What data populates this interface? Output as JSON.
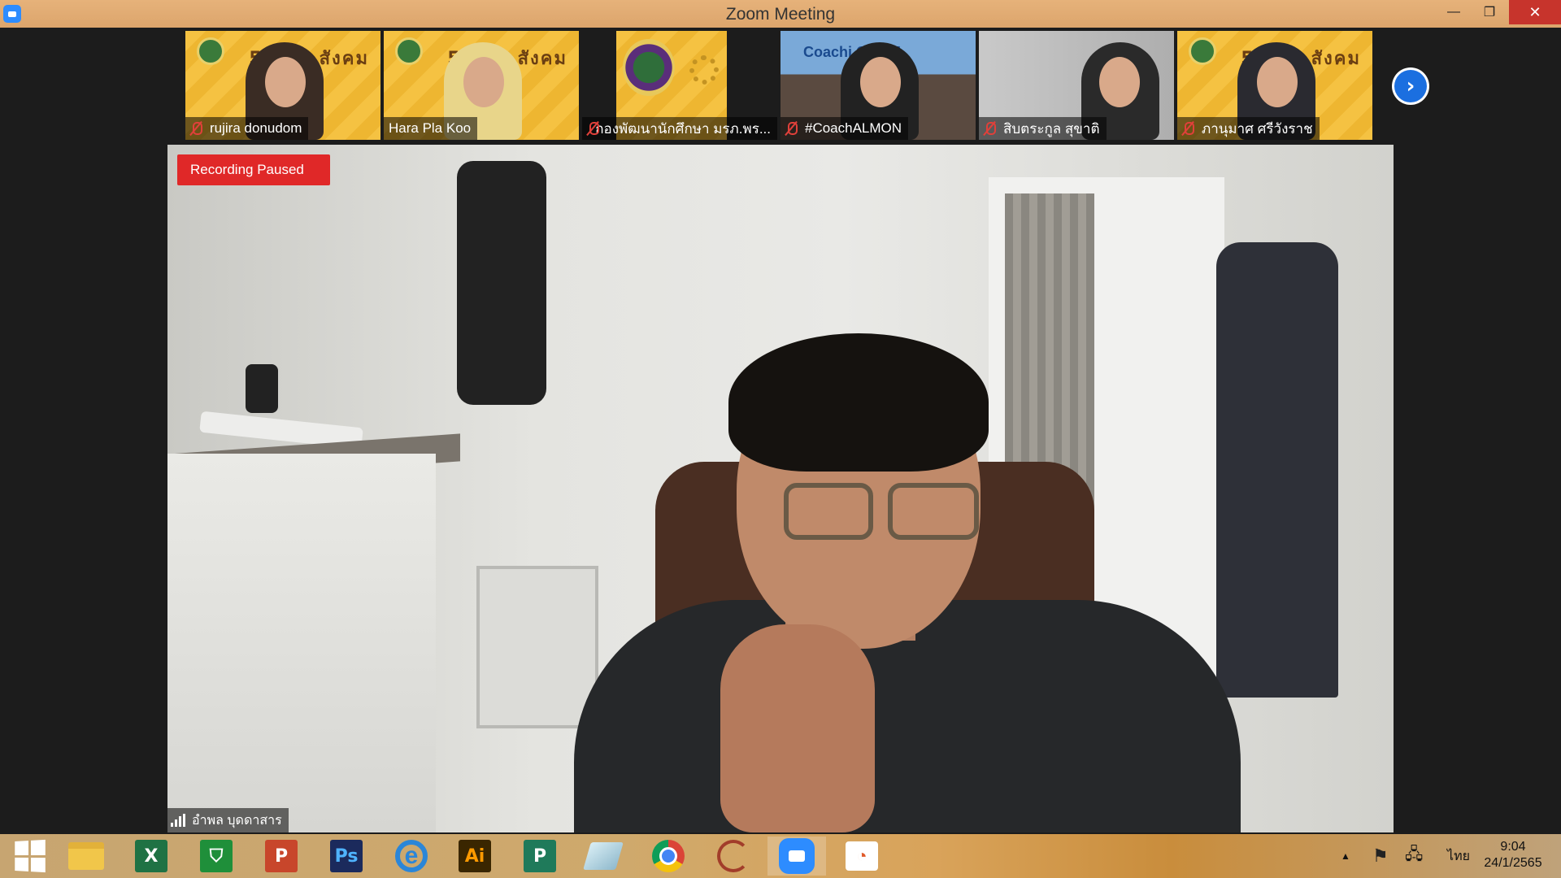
{
  "window": {
    "title": "Zoom Meeting",
    "minimize_glyph": "—",
    "restore_glyph": "❐",
    "close_glyph": "✕"
  },
  "participants": [
    {
      "name": "rujira donudom",
      "muted": true
    },
    {
      "name": "Hara Pla Koo",
      "muted": false
    },
    {
      "name": "กองพัฒนานักศึกษา มรภ.พร...",
      "muted": true
    },
    {
      "name": "#CoachALMON",
      "muted": true,
      "headline": "Coachi GRAM"
    },
    {
      "name": "สิบตระกูล สุขาติ",
      "muted": true
    },
    {
      "name": "ภานุมาศ ศรีวังราช",
      "muted": true
    }
  ],
  "thumb_brand": "5ศวกร สังคม",
  "strip_next_glyph": "›",
  "speaker": {
    "recording_status": "Recording Paused",
    "name": "อำพล บุดดาสาร"
  },
  "taskbar": {
    "apps": [
      {
        "id": "start",
        "icon": "windows-icon"
      },
      {
        "id": "explorer",
        "icon": "folder-icon"
      },
      {
        "id": "excel",
        "icon": "excel-icon",
        "glyph": "X",
        "color": "#1f7244"
      },
      {
        "id": "store",
        "icon": "store-icon",
        "glyph": "⛉",
        "color": "#1f8f3a"
      },
      {
        "id": "powerpoint",
        "icon": "powerpoint-icon",
        "glyph": "P",
        "color": "#c8462b"
      },
      {
        "id": "photoshop",
        "icon": "photoshop-icon",
        "glyph": "Ps",
        "color": "#1b2a5c"
      },
      {
        "id": "ie",
        "icon": "internet-explorer-icon",
        "glyph": "e"
      },
      {
        "id": "illustrator",
        "icon": "illustrator-icon",
        "glyph": "Ai",
        "color": "#3a2600"
      },
      {
        "id": "publisher",
        "icon": "publisher-icon",
        "glyph": "P",
        "color": "#1f7a5a"
      },
      {
        "id": "sketch",
        "icon": "sketch-icon"
      },
      {
        "id": "chrome",
        "icon": "chrome-icon"
      },
      {
        "id": "pen",
        "icon": "pen-tool-icon"
      },
      {
        "id": "zoom",
        "icon": "zoom-icon",
        "active": true
      },
      {
        "id": "slides",
        "icon": "slides-icon",
        "glyph": "◔"
      }
    ],
    "tray": {
      "show_hidden_glyph": "▲",
      "flag_glyph": "⚑",
      "network_glyph": "🖧",
      "language": "ไทย"
    },
    "clock": {
      "time": "9:04",
      "date": "24/1/2565"
    }
  }
}
